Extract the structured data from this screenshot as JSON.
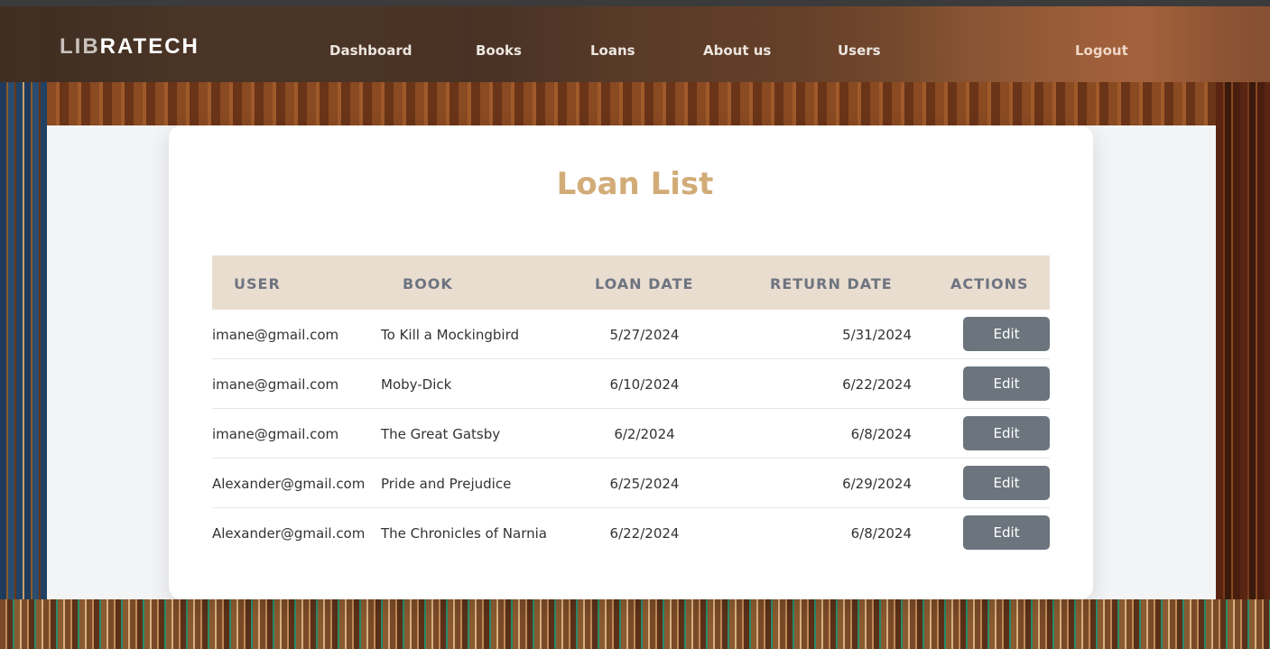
{
  "brand": {
    "prefix": "LIB",
    "suffix": "RATECH"
  },
  "nav": {
    "dashboard": "Dashboard",
    "books": "Books",
    "loans": "Loans",
    "about": "About us",
    "users": "Users",
    "logout": "Logout"
  },
  "page": {
    "title": "Loan List"
  },
  "table": {
    "headers": {
      "user": "USER",
      "book": "BOOK",
      "loan_date": "LOAN DATE",
      "return_date": "RETURN DATE",
      "actions": "ACTIONS"
    },
    "rows": [
      {
        "user": "imane@gmail.com",
        "book": "To Kill a Mockingbird",
        "loan_date": "5/27/2024",
        "return_date": "5/31/2024",
        "action": "Edit"
      },
      {
        "user": "imane@gmail.com",
        "book": "Moby-Dick",
        "loan_date": "6/10/2024",
        "return_date": "6/22/2024",
        "action": "Edit"
      },
      {
        "user": "imane@gmail.com",
        "book": "The Great Gatsby",
        "loan_date": "6/2/2024",
        "return_date": "6/8/2024",
        "action": "Edit"
      },
      {
        "user": "Alexander@gmail.com",
        "book": "Pride and Prejudice",
        "loan_date": "6/25/2024",
        "return_date": "6/29/2024",
        "action": "Edit"
      },
      {
        "user": "Alexander@gmail.com",
        "book": "The Chronicles of Narnia",
        "loan_date": "6/22/2024",
        "return_date": "6/8/2024",
        "action": "Edit"
      }
    ]
  },
  "colors": {
    "title": "#d2ac78",
    "header_bg": "#e9ddd0",
    "header_text": "#6e7480",
    "button_bg": "#6c757d"
  }
}
